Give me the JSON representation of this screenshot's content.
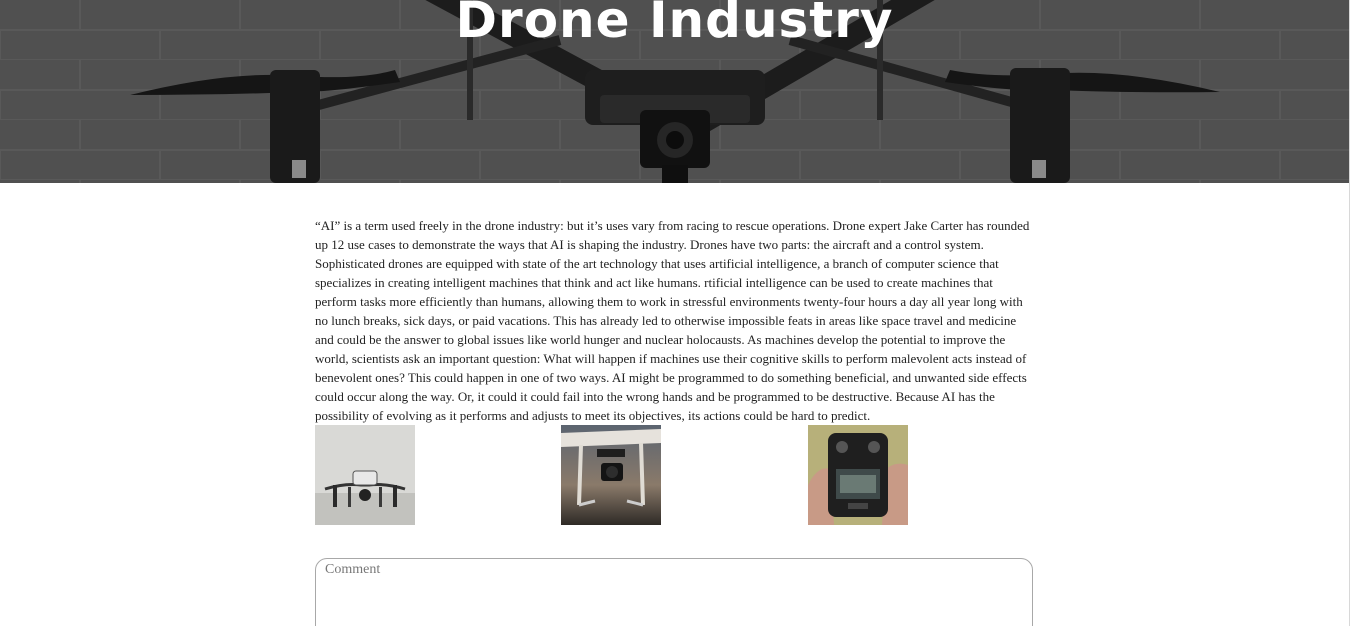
{
  "hero": {
    "title": "Drone Industry"
  },
  "article": {
    "body": "“AI” is a term used freely in the drone industry: but it’s uses vary from racing to rescue operations. Drone expert Jake Carter has rounded up 12 use cases to demonstrate the ways that AI is shaping the industry. Drones have two parts: the aircraft and a control system. Sophisticated drones are equipped with state of the art technology that uses artificial intelligence, a branch of computer science that specializes in creating intelligent machines that think and act like humans. rtificial intelligence can be used to create machines that perform tasks more efficiently than humans, allowing them to work in stressful environments twenty-four hours a day all year long with no lunch breaks, sick days, or paid vacations. This has already led to otherwise impossible feats in areas like space travel and medicine and could be the answer to global issues like world hunger and nuclear holocausts. As machines develop the potential to improve the world, scientists ask an important question: What will happen if machines use their cognitive skills to perform malevolent acts instead of benevolent ones? This could happen in one of two ways. AI might be programmed to do something beneficial, and unwanted side effects could occur along the way. Or, it could it could fail into the wrong hands and be programmed to be destructive. Because AI has the possibility of evolving as it performs and adjusts to meet its objectives, its actions could be hard to predict."
  },
  "gallery": {
    "images": [
      {
        "icon": "white-drone-on-floor-photo"
      },
      {
        "icon": "drone-with-camera-in-sky-photo"
      },
      {
        "icon": "drone-remote-controller-photo"
      }
    ]
  },
  "comment": {
    "placeholder": "Comment",
    "value": ""
  },
  "colors": {
    "hero_overlay": "#4a4a4a",
    "title": "#ffffff",
    "text": "#222222",
    "border": "#a8a8a8"
  }
}
